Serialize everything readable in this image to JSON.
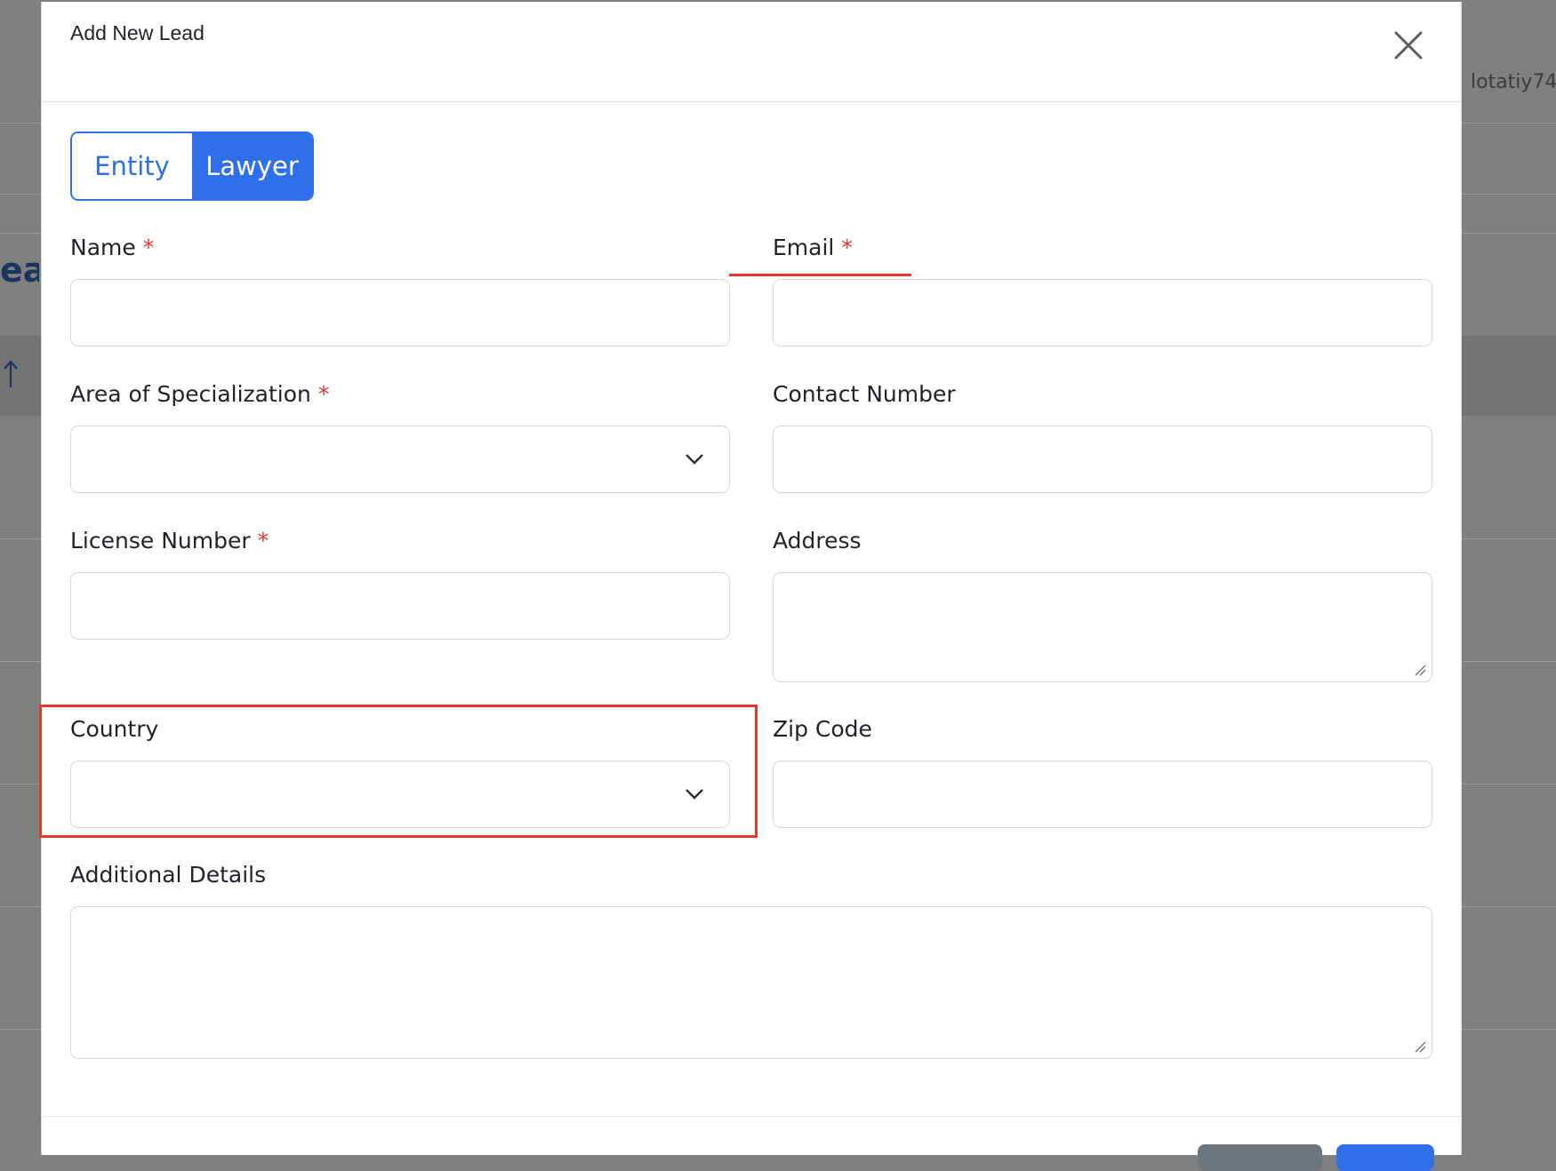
{
  "background": {
    "user_name": "lotatiy74",
    "page_heading_fragment": "ead"
  },
  "modal": {
    "title": "Add New Lead",
    "close_icon": "close-icon",
    "lead_type_toggle": {
      "options": [
        "Entity",
        "Lawyer"
      ],
      "selected": "Lawyer"
    },
    "fields": {
      "name": {
        "label": "Name",
        "required": "*",
        "value": ""
      },
      "email": {
        "label": "Email",
        "required": "*",
        "value": ""
      },
      "area_of_specialization": {
        "label": "Area of Specialization",
        "required": "*",
        "value": ""
      },
      "contact_number": {
        "label": "Contact Number",
        "value": ""
      },
      "license_number": {
        "label": "License Number",
        "required": "*",
        "value": ""
      },
      "address": {
        "label": "Address",
        "value": ""
      },
      "country": {
        "label": "Country",
        "value": ""
      },
      "zip_code": {
        "label": "Zip Code",
        "value": ""
      },
      "additional_details": {
        "label": "Additional Details",
        "value": ""
      }
    }
  },
  "colors": {
    "accent": "#2f6fea",
    "required": "#e03c2b",
    "highlight": "#e03c2b"
  }
}
